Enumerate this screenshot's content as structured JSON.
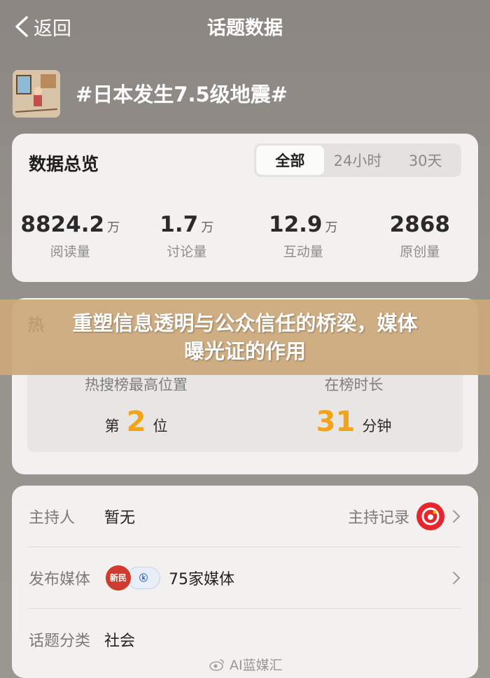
{
  "header": {
    "back_label": "返回",
    "title": "话题数据"
  },
  "topic": {
    "title": "#日本发生7.5级地震#"
  },
  "overview": {
    "heading": "数据总览",
    "tabs": [
      {
        "label": "全部",
        "active": true
      },
      {
        "label": "24小时",
        "active": false
      },
      {
        "label": "30天",
        "active": false
      }
    ],
    "stats": [
      {
        "value": "8824.2",
        "unit": "万",
        "label": "阅读量"
      },
      {
        "value": "1.7",
        "unit": "万",
        "label": "讨论量"
      },
      {
        "value": "12.9",
        "unit": "万",
        "label": "互动量"
      },
      {
        "value": "2868",
        "unit": "",
        "label": "原创量"
      }
    ]
  },
  "hot": {
    "heading": "热",
    "rank_label": "热搜榜最高位置",
    "rank_prefix": "第",
    "rank_value": "2",
    "rank_suffix": "位",
    "duration_label": "在榜时长",
    "duration_value": "31",
    "duration_unit": "分钟"
  },
  "info": {
    "host_label": "主持人",
    "host_value": "暂无",
    "host_record": "主持记录",
    "media_label": "发布媒体",
    "media_logo1": "新民",
    "media_logo2": "ⓚ",
    "media_value": "75家媒体",
    "category_label": "话题分类",
    "category_value": "社会"
  },
  "banner": {
    "line1": "重塑信息透明与公众信任的桥梁，媒体",
    "line2": "曝光证的作用"
  },
  "watermark": {
    "text": "AI蓝媒汇"
  },
  "colors": {
    "accent_orange": "#f2a316",
    "brand_red": "#e5262c"
  }
}
